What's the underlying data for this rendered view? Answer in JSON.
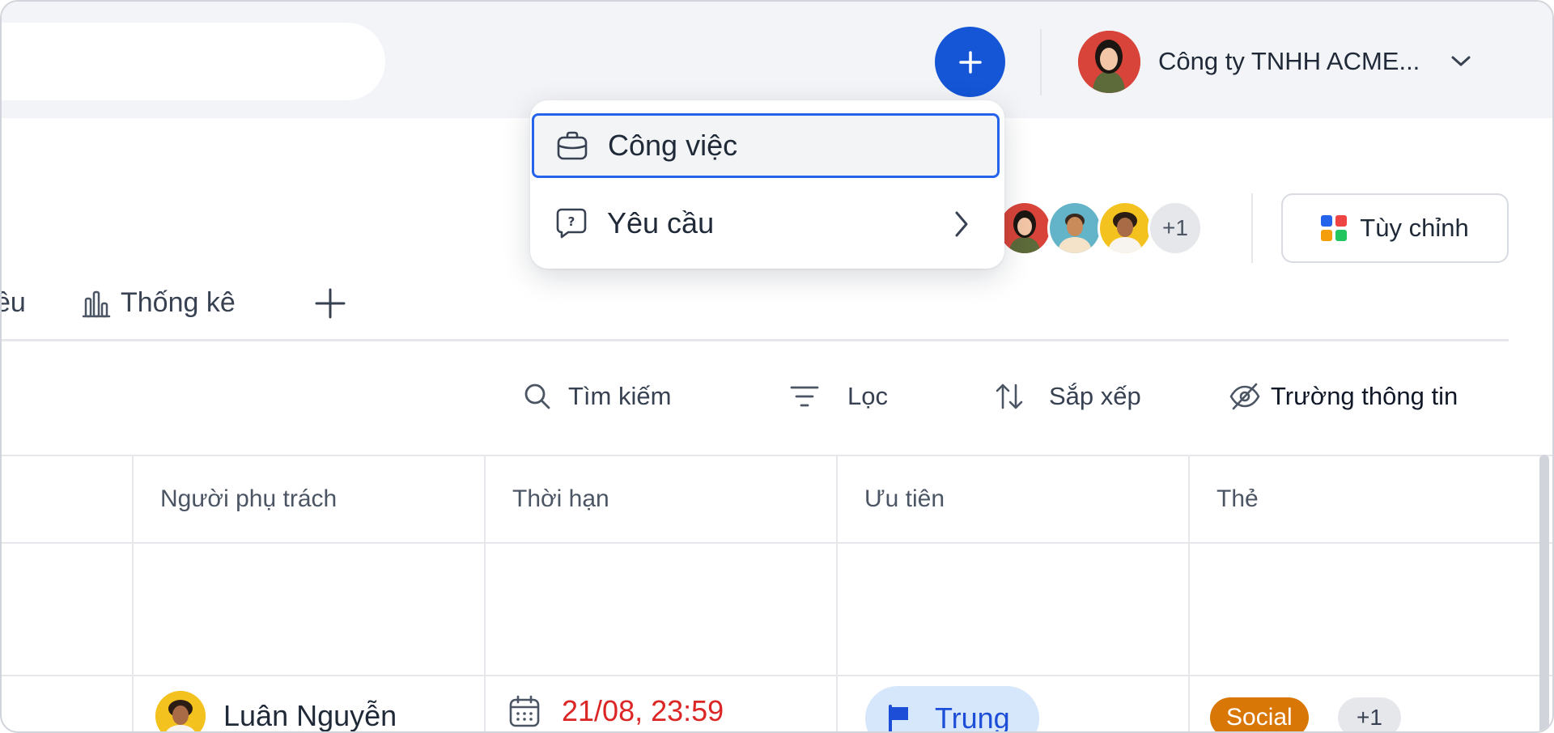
{
  "topbar": {
    "company_name": "Công ty TNHH ACME...",
    "add_button_icon": "plus-icon",
    "brand_color": "#1456d6"
  },
  "menu": {
    "items": [
      {
        "label": "Công việc",
        "icon": "briefcase-icon",
        "active": true
      },
      {
        "label": "Yêu cầu",
        "icon": "question-bubble-icon",
        "has_submenu": true
      }
    ]
  },
  "members": {
    "more_count": "+1"
  },
  "customize_button": {
    "label": "Tùy chỉnh"
  },
  "tabs": {
    "partial_label": "ều",
    "stats_label": "Thống kê"
  },
  "toolbar": {
    "search_label": "Tìm kiếm",
    "filter_label": "Lọc",
    "sort_label": "Sắp xếp",
    "fields_label": "Trường thông tin"
  },
  "table": {
    "columns": [
      "Người phụ trách",
      "Thời hạn",
      "Ưu tiên",
      "Thẻ"
    ],
    "rows": [
      {
        "assignee": "Luân Nguyễn",
        "deadline": "21/08, 23:59",
        "priority": "Trung",
        "tag": "Social",
        "tag_more": "+1"
      }
    ]
  },
  "colors": {
    "deadline_overdue": "#dc2626",
    "priority_medium_bg": "#d6e6fb",
    "tag_social": "#d97706"
  }
}
